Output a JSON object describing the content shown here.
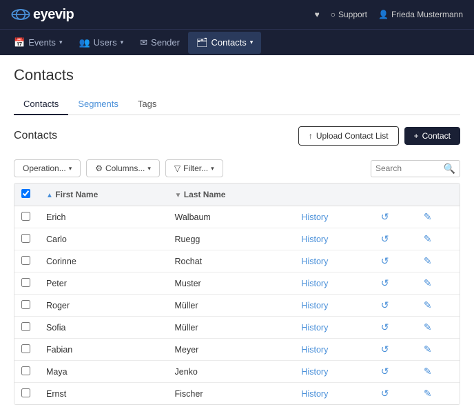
{
  "navbar": {
    "logo_text": "eyevip",
    "support_label": "Support",
    "user_label": "Frieda Mustermann",
    "heart_icon": "♥"
  },
  "subnav": {
    "items": [
      {
        "id": "events",
        "label": "Events",
        "icon": "📅",
        "has_dropdown": true
      },
      {
        "id": "users",
        "label": "Users",
        "icon": "👥",
        "has_dropdown": true
      },
      {
        "id": "sender",
        "label": "Sender",
        "icon": "✉",
        "has_dropdown": false
      },
      {
        "id": "contacts",
        "label": "Contacts",
        "icon": "🗂",
        "has_dropdown": true,
        "active": true
      }
    ]
  },
  "page": {
    "title": "Contacts"
  },
  "tabs": [
    {
      "id": "contacts",
      "label": "Contacts",
      "active": true
    },
    {
      "id": "segments",
      "label": "Segments",
      "blue": true
    },
    {
      "id": "tags",
      "label": "Tags",
      "blue": false
    }
  ],
  "contacts_section": {
    "title": "Contacts",
    "upload_button": "Upload Contact List",
    "add_button": "Contact"
  },
  "toolbar": {
    "operation_button": "Operation...",
    "columns_button": "Columns...",
    "filter_button": "Filter...",
    "search_placeholder": "Search"
  },
  "table": {
    "columns": [
      {
        "id": "check",
        "label": "",
        "sortable": false
      },
      {
        "id": "first_name",
        "label": "First Name",
        "sortable": true
      },
      {
        "id": "last_name",
        "label": "Last Name",
        "sortable": true
      }
    ],
    "rows": [
      {
        "first_name": "Erich",
        "last_name": "Walbaum"
      },
      {
        "first_name": "Carlo",
        "last_name": "Ruegg"
      },
      {
        "first_name": "Corinne",
        "last_name": "Rochat"
      },
      {
        "first_name": "Peter",
        "last_name": "Muster"
      },
      {
        "first_name": "Roger",
        "last_name": "Müller"
      },
      {
        "first_name": "Sofia",
        "last_name": "Müller"
      },
      {
        "first_name": "Fabian",
        "last_name": "Meyer"
      },
      {
        "first_name": "Maya",
        "last_name": "Jenko"
      },
      {
        "first_name": "Ernst",
        "last_name": "Fischer"
      }
    ],
    "history_label": "History",
    "refresh_symbol": "↺",
    "edit_symbol": "✎"
  },
  "colors": {
    "navbar_bg": "#1a2035",
    "accent_blue": "#4a90d9",
    "link_blue": "#4a90d9",
    "btn_dark": "#1a2035"
  }
}
